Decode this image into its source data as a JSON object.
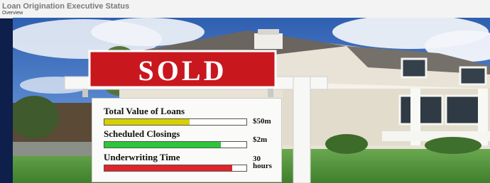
{
  "header": {
    "title": "Loan Origination Executive Status",
    "subtitle": "Overview"
  },
  "sign": {
    "banner": "SOLD",
    "metrics": [
      {
        "label": "Total Value of Loans",
        "value": "$50m",
        "fill": 0.6,
        "color": "#d7d000"
      },
      {
        "label": "Scheduled Closings",
        "value": "$2m",
        "fill": 0.82,
        "color": "#2cc63a"
      },
      {
        "label": "Underwriting Time",
        "value": "30 hours",
        "value_line1": "30",
        "value_line2": "hours",
        "fill": 0.9,
        "color": "#e0242a"
      }
    ]
  }
}
